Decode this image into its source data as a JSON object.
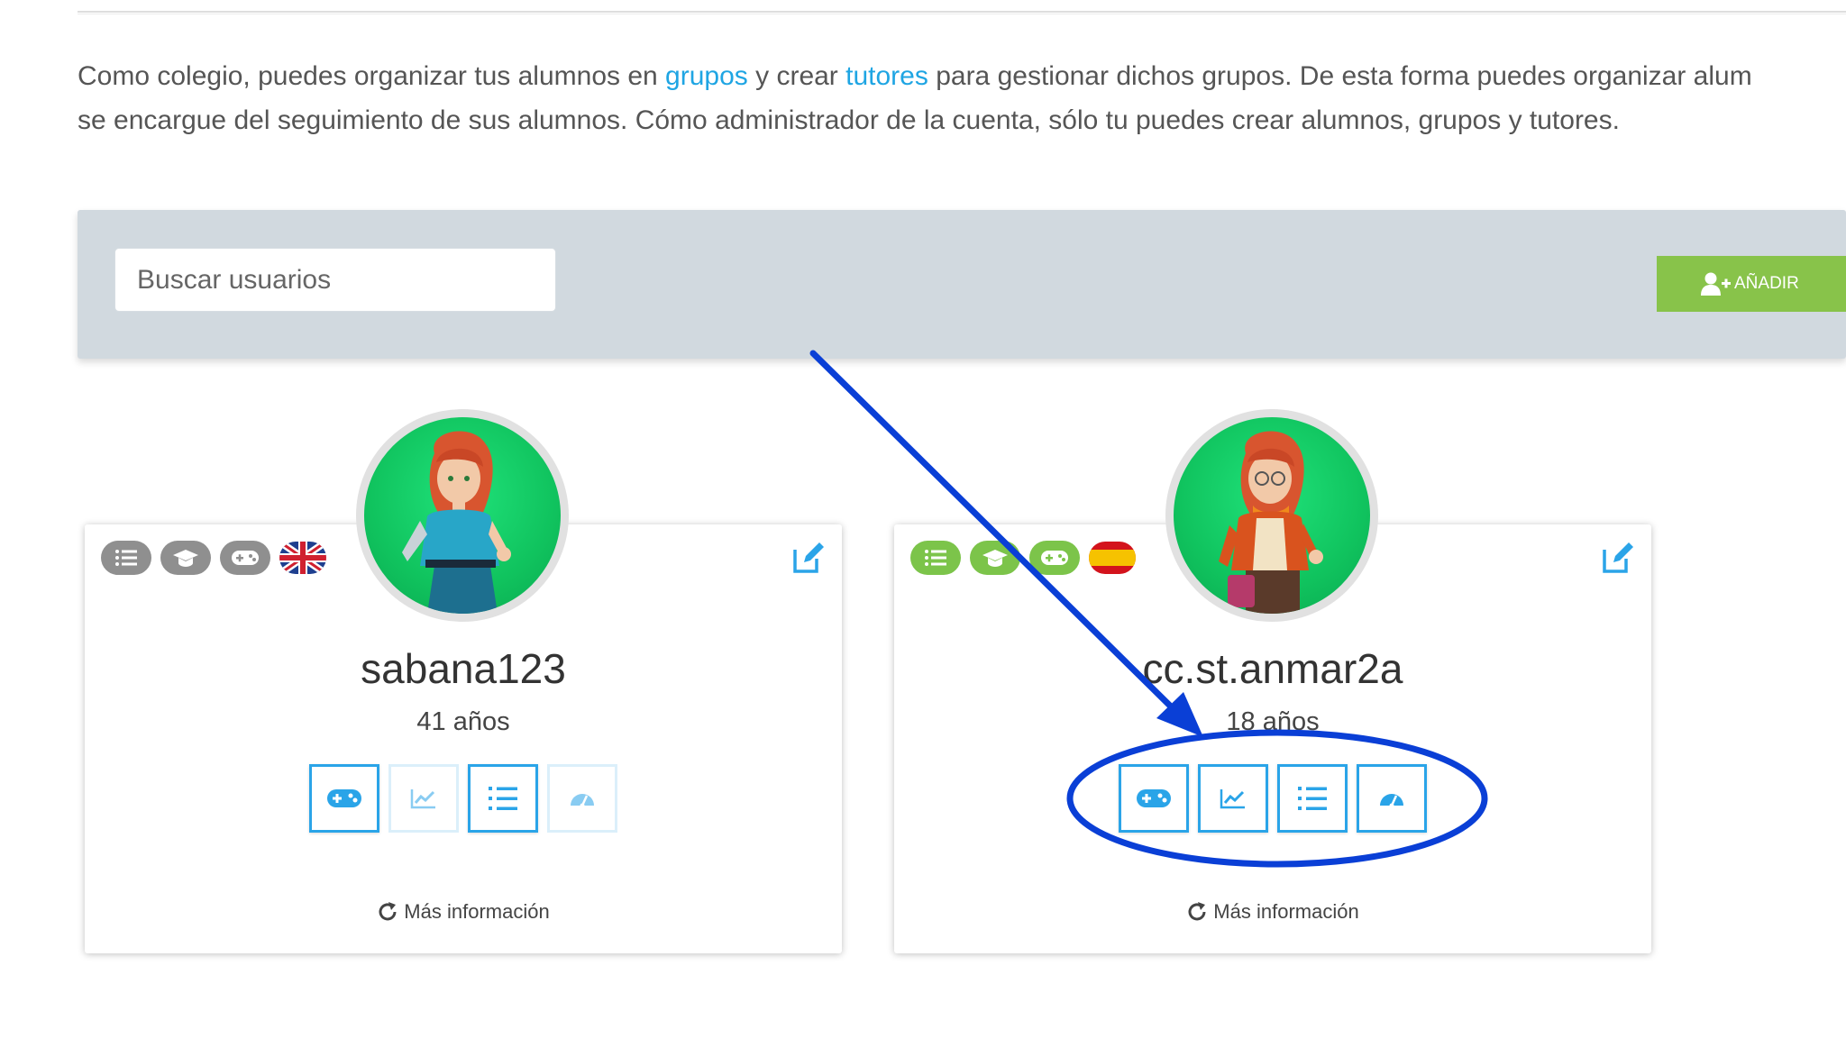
{
  "intro": {
    "line1_a": "Como colegio, puedes organizar tus alumnos en ",
    "link_groups": "grupos",
    "line1_b": " y crear ",
    "link_tutors": "tutores",
    "line1_c": " para gestionar dichos grupos. De esta forma puedes organizar alum",
    "line2": "se encargue del seguimiento de sus alumnos. Cómo administrador de la cuenta, sólo tu puedes crear alumnos, grupos y tutores."
  },
  "toolbar": {
    "search_placeholder": "Buscar usuarios",
    "add_label": "AÑADIR"
  },
  "users": [
    {
      "username": "sabana123",
      "age": "41 años",
      "badge_color": "#8f8f8f",
      "flag": "uk-flag-icon",
      "more_label": "Más información",
      "actions_enabled": [
        true,
        false,
        true,
        false
      ]
    },
    {
      "username": "cc.st.anmar2a",
      "age": "18 años",
      "badge_color": "#7cc44a",
      "flag": "spain-flag-icon",
      "more_label": "Más información",
      "actions_enabled": [
        true,
        true,
        true,
        true
      ]
    }
  ],
  "colors": {
    "link": "#1fa5e3",
    "toolbar_bg": "#d1d9df",
    "add_button": "#88c34a",
    "action_border": "#2aa4e8",
    "annotation": "#0a3fd6"
  }
}
